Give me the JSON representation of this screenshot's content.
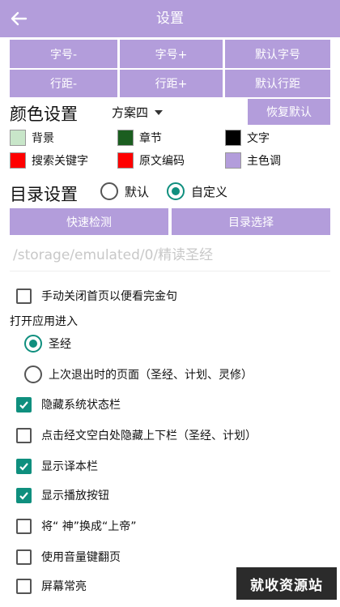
{
  "header": {
    "title": "设置"
  },
  "font_buttons": [
    "字号-",
    "字号+",
    "默认字号"
  ],
  "spacing_buttons": [
    "行距-",
    "行距+",
    "默认行距"
  ],
  "color_settings": {
    "title": "颜色设置",
    "scheme": "方案四",
    "reset_label": "恢复默认",
    "swatches": [
      {
        "label": "背景",
        "color": "#c8e6c9"
      },
      {
        "label": "章节",
        "color": "#1b5e20"
      },
      {
        "label": "文字",
        "color": "#000000"
      },
      {
        "label": "搜索关键字",
        "color": "#ff0000"
      },
      {
        "label": "原文编码",
        "color": "#ff0000"
      },
      {
        "label": "主色调",
        "color": "#b39ddb"
      }
    ]
  },
  "dir_settings": {
    "title": "目录设置",
    "option_default": "默认",
    "option_custom": "自定义",
    "selected": "自定义",
    "quick_detect": "快速检测",
    "dir_select": "目录选择",
    "path": "/storage/emulated/0/精读圣经"
  },
  "options": {
    "manual_close": {
      "label": "手动关闭首页以便看完金句",
      "checked": false
    },
    "open_app_label": "打开应用进入",
    "open_app_choices": [
      "圣经",
      "上次退出时的页面（圣经、计划、灵修）"
    ],
    "open_app_selected": 0,
    "hide_status_bar": {
      "label": "隐藏系统状态栏",
      "checked": true
    },
    "tap_hide_bars": {
      "label": "点击经文空白处隐藏上下栏（圣经、计划）",
      "checked": false
    },
    "show_version_bar": {
      "label": "显示译本栏",
      "checked": true
    },
    "show_play_button": {
      "label": "显示播放按钮",
      "checked": true
    },
    "replace_god": {
      "label": "将“ 神”换成“上帝”",
      "checked": false
    },
    "volume_page": {
      "label": "使用音量键翻页",
      "checked": false
    },
    "screen_on": {
      "label": "屏幕常亮",
      "checked": false
    }
  },
  "watermark": "就收资源站"
}
